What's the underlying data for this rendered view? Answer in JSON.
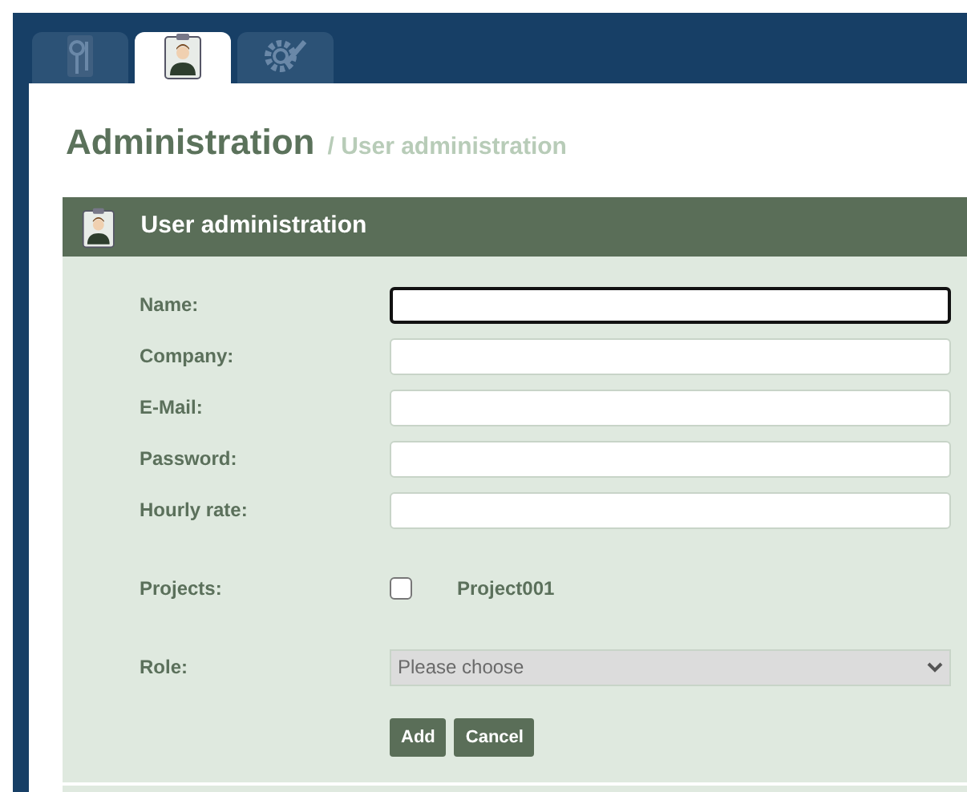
{
  "tabs": [
    {
      "kind": "tools",
      "selected": false
    },
    {
      "kind": "user",
      "selected": true
    },
    {
      "kind": "settings",
      "selected": false
    }
  ],
  "heading": {
    "title": "Administration",
    "breadcrumb": "/ User administration"
  },
  "panel": {
    "title": "User administration",
    "fields": [
      {
        "label": "Name:",
        "focused": true
      },
      {
        "label": "Company:",
        "focused": false
      },
      {
        "label": "E-Mail:",
        "focused": false
      },
      {
        "label": "Password:",
        "focused": false
      },
      {
        "label": "Hourly rate:",
        "focused": false
      }
    ],
    "projects": {
      "label": "Projects:",
      "items": [
        {
          "name": "Project001",
          "checked": false
        }
      ]
    },
    "role": {
      "label": "Role:",
      "placeholder": "Please choose"
    },
    "buttons": [
      "Add",
      "Cancel"
    ]
  }
}
